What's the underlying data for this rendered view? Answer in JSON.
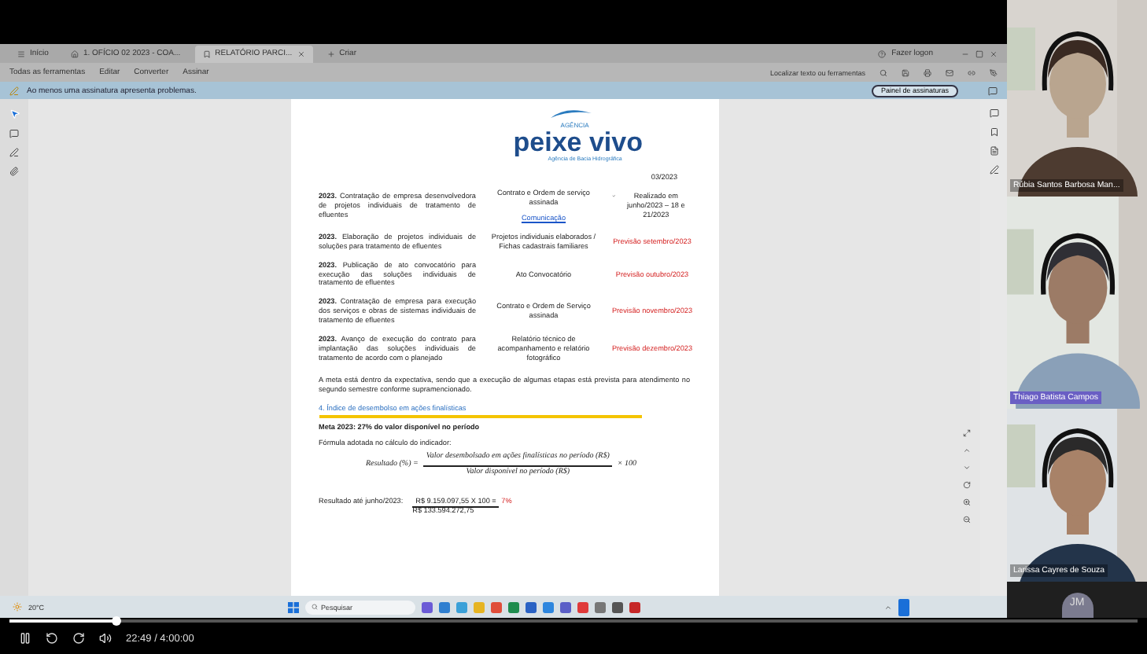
{
  "browser": {
    "tabs": [
      {
        "label": "Início",
        "kind": "menu",
        "selected": false
      },
      {
        "label": "1. OFÍCIO 02 2023 - COA...",
        "kind": "home",
        "selected": false
      },
      {
        "label": "RELATÓRIO PARCI...",
        "kind": "doc",
        "selected": true
      },
      {
        "label": "Criar",
        "kind": "new",
        "selected": false
      }
    ],
    "sign_in": "Fazer logon",
    "menu": [
      "Todas as ferramentas",
      "Editar",
      "Converter",
      "Assinar"
    ],
    "search_hint": "Localizar texto ou ferramentas",
    "notice": "Ao menos uma assinatura apresenta problemas.",
    "notice_button": "Painel de assinaturas"
  },
  "document": {
    "logo_small": "AGÊNCIA",
    "logo": "peixe vivo",
    "logo_tagline": "Agência de Bacia Hidrográfica",
    "date": "03/2023",
    "rows": [
      {
        "description": "**2023.** Contratação de empresa desenvolvedora de projetos individuais de tratamento de efluentes",
        "product": "Contrato e Ordem de serviço assinada",
        "link": "Comunicação",
        "status": "Realizado em junho/2023 – 18 e 21/2023",
        "done": true
      },
      {
        "description": "**2023.** Elaboração de projetos individuais de soluções para tratamento de efluentes",
        "product": "Projetos individuais elaborados / Fichas cadastrais familiares",
        "status": "Previsão setembro/2023",
        "done": false
      },
      {
        "description": "**2023.** Publicação de ato convocatório para execução das soluções individuais de tratamento de efluentes",
        "product": "Ato Convocatório",
        "status": "Previsão outubro/2023",
        "done": false
      },
      {
        "description": "**2023.** Contratação de empresa para execução dos serviços e obras de sistemas individuais de tratamento de efluentes",
        "product": "Contrato e Ordem de Serviço assinada",
        "status": "Previsão novembro/2023",
        "done": false
      },
      {
        "description": "**2023.** Avanço de execução do contrato para implantação das soluções individuais de tratamento de acordo com o planejado",
        "product": "Relatório técnico de acompanhamento e relatório fotográfico",
        "status": "Previsão dezembro/2023",
        "done": false
      }
    ],
    "paragraph": "A meta está dentro da expectativa, sendo que a execução de algumas etapas está prevista para atendimento no segundo semestre conforme supramencionado.",
    "section_heading": "4. Índice de desembolso em ações finalísticas",
    "goal": "Meta 2023: 27% do valor disponível no período",
    "formula_intro": "Fórmula adotada no cálculo do indicador:",
    "formula": {
      "lhs": "Resultado (%) =",
      "numerator": "Valor desembolsado em ações finalísticas no período (R$)",
      "denominator": "Valor disponível no período (R$)",
      "times": "× 100"
    },
    "result": {
      "label": "Resultado até junho/2023:",
      "numerator": "R$ 9.159.097,55 X 100 =",
      "value": "7%",
      "denominator": "R$ 133.594.272,75"
    }
  },
  "taskbar": {
    "weather": "20°C",
    "search_placeholder": "Pesquisar"
  },
  "participants": [
    {
      "name": "Rúbia Santos Barbosa Man..."
    },
    {
      "name": "Thiago Batista Campos"
    },
    {
      "name": "Larissa Cayres de Souza"
    }
  ],
  "avatar": {
    "initials": "JM"
  },
  "player": {
    "level": 0.095,
    "time": "22:49 / 4:00:00"
  }
}
